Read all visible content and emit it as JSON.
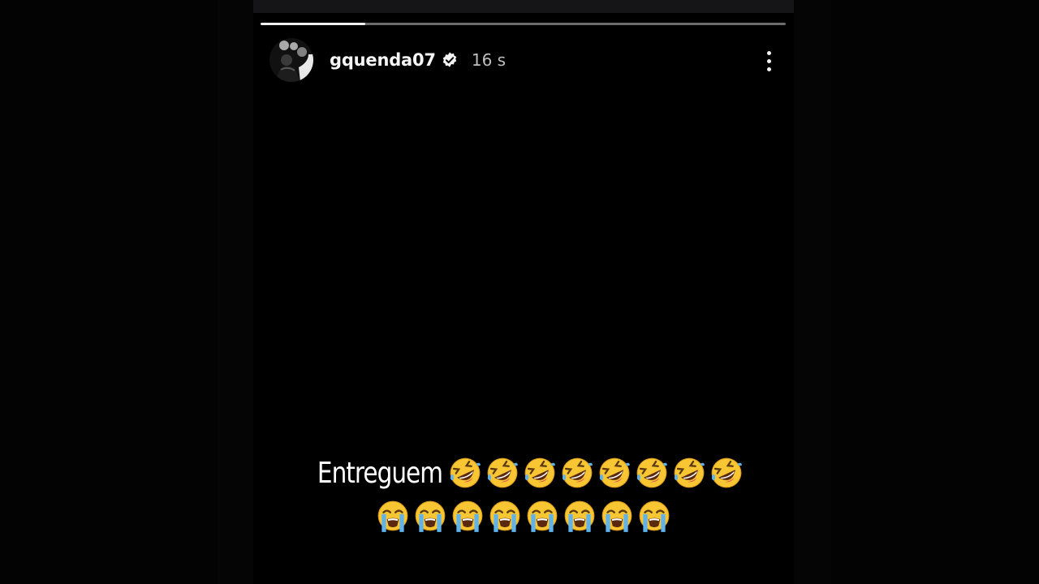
{
  "story": {
    "progress_fraction": 0.2,
    "user": {
      "username": "gquenda07",
      "verified": true,
      "time_ago": "16 s"
    },
    "avatar_icon": "profile-photo",
    "more_icon": "more-vertical-icon",
    "caption": {
      "text": "Entreguem",
      "line1_emojis": [
        "rolling-on-floor-laughing",
        "rolling-on-floor-laughing",
        "rolling-on-floor-laughing",
        "rolling-on-floor-laughing",
        "rolling-on-floor-laughing",
        "rolling-on-floor-laughing",
        "rolling-on-floor-laughing",
        "rolling-on-floor-laughing"
      ],
      "line2_emojis": [
        "loudly-crying-face",
        "loudly-crying-face",
        "loudly-crying-face",
        "loudly-crying-face",
        "loudly-crying-face",
        "loudly-crying-face",
        "loudly-crying-face",
        "loudly-crying-face"
      ]
    }
  },
  "colors": {
    "background": "#030303",
    "story_background": "#000000",
    "text": "#ffffff",
    "muted_text": "#bfbfbf",
    "verified_badge": "#f2f2f2",
    "emoji_yellow": "#f7c632",
    "tear_blue": "#5fb3ea"
  }
}
